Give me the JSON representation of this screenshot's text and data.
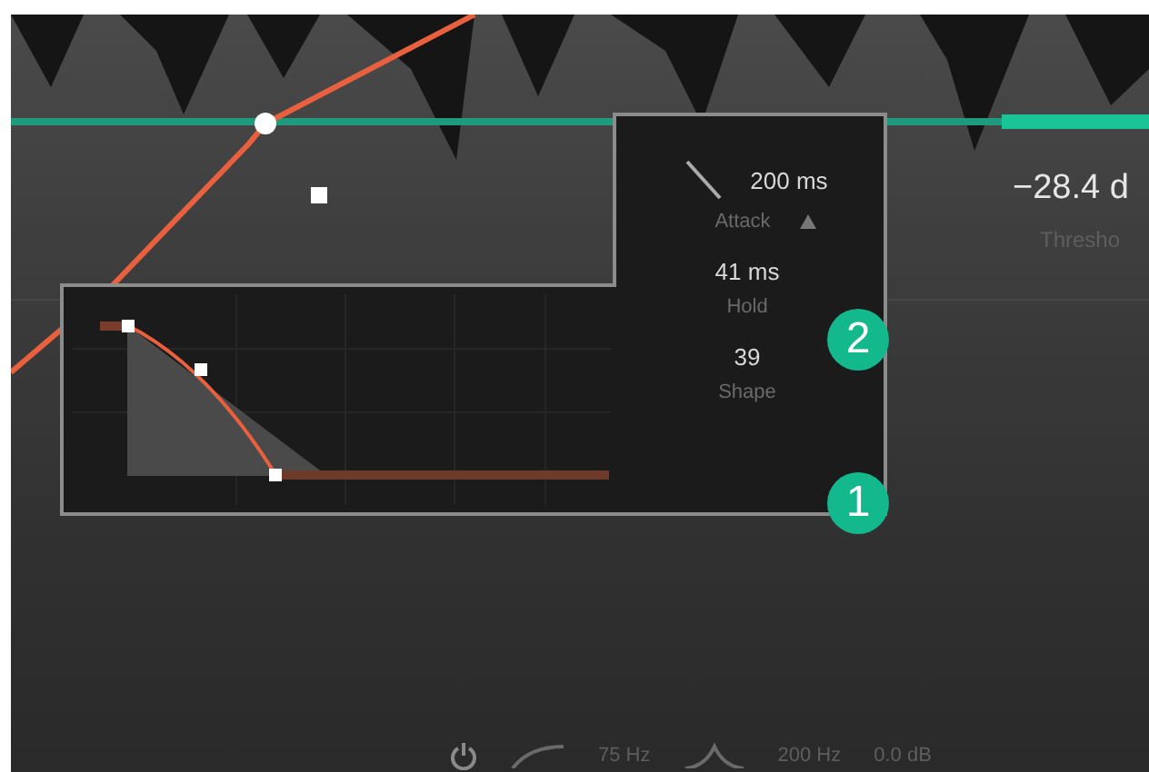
{
  "threshold": {
    "value": "−28.4 d",
    "label": "Thresho"
  },
  "envelope_popup": {
    "params": [
      {
        "kind": "attack",
        "value": "200 ms",
        "label": "Attack"
      },
      {
        "kind": "plain",
        "value": "41 ms",
        "label": "Hold"
      },
      {
        "kind": "plain",
        "value": "39",
        "label": "Shape"
      }
    ]
  },
  "callouts": [
    {
      "number": "2",
      "kind": "upper"
    },
    {
      "number": "1",
      "kind": "lower"
    }
  ],
  "band_bar": {
    "low_freq": "75 Hz",
    "high_freq": "200 Hz",
    "gain": "0.0 dB"
  }
}
